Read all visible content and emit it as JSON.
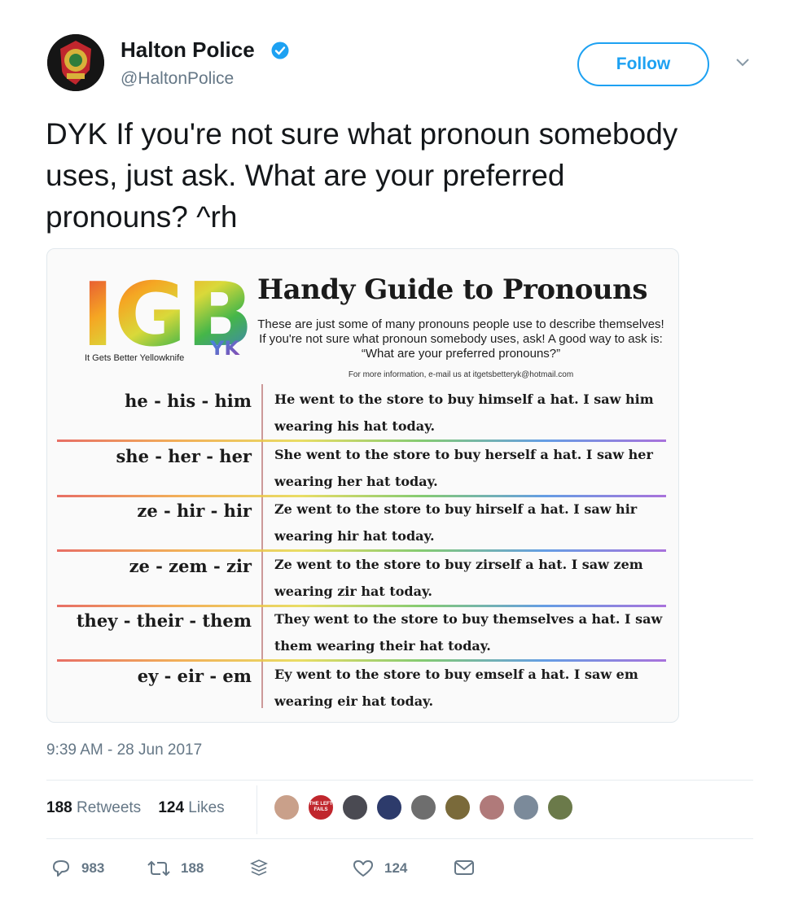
{
  "user": {
    "display_name": "Halton Police",
    "handle": "@HaltonPolice",
    "avatar_icon": "police-badge-icon",
    "verified_icon": "verified-badge-icon",
    "follow_label": "Follow",
    "menu_icon": "chevron-down-icon"
  },
  "tweet": {
    "text": "DYK If you're not sure what pronoun somebody uses, just ask. What are your preferred pronouns? ^rh",
    "timestamp": "9:39 AM - 28 Jun 2017"
  },
  "image": {
    "logo_text": "IGB",
    "logo_sub": "YK",
    "tagline": "It Gets Better Yellowknife",
    "title": "Handy Guide to Pronouns",
    "description": "These are just some of many pronouns people use to describe themselves! If you're not sure what pronoun somebody uses, ask! A good way to ask is: “What are your preferred pronouns?”",
    "contact": "For more information, e-mail us at itgetsbetteryk@hotmail.com",
    "rows": [
      {
        "pronouns": "he - his - him",
        "example": "He went to the store to buy himself a hat. I saw him wearing his hat today."
      },
      {
        "pronouns": "she - her - her",
        "example": "She went to the store to buy herself a hat. I saw her wearing her hat today."
      },
      {
        "pronouns": "ze - hir - hir",
        "example": "Ze went to the store to buy hirself a hat. I saw hir wearing hir hat today."
      },
      {
        "pronouns": "ze - zem - zir",
        "example": "Ze went to the store to buy zirself a hat. I saw zem wearing zir hat today."
      },
      {
        "pronouns": "they - their - them",
        "example": "They went to the store to buy themselves a hat. I saw them wearing their hat today."
      },
      {
        "pronouns": "ey - eir - em",
        "example": "Ey went to the store to buy emself a hat. I saw em wearing eir hat today."
      }
    ]
  },
  "stats": {
    "retweets_count": "188",
    "retweets_label": "Retweets",
    "likes_count": "124",
    "likes_label": "Likes",
    "liker_avatar_colors": [
      "#c9a08a",
      "#c0262d",
      "#4a4a52",
      "#2d3b6b",
      "#6e6e6e",
      "#7a6a3a",
      "#b07a7a",
      "#7b8a9a",
      "#6b7a4a"
    ],
    "liker_avatar_labels": [
      "",
      "THE LEFT FAILS",
      "",
      "",
      "",
      "",
      "",
      "",
      ""
    ]
  },
  "actions": {
    "reply_count": "983",
    "retweet_count": "188",
    "like_count": "124",
    "reply_icon": "reply-icon",
    "retweet_icon": "retweet-icon",
    "stack_icon": "stack-icon",
    "like_icon": "heart-icon",
    "dm_icon": "envelope-icon"
  },
  "colors": {
    "accent": "#1da1f2",
    "secondary_text": "#657786"
  }
}
